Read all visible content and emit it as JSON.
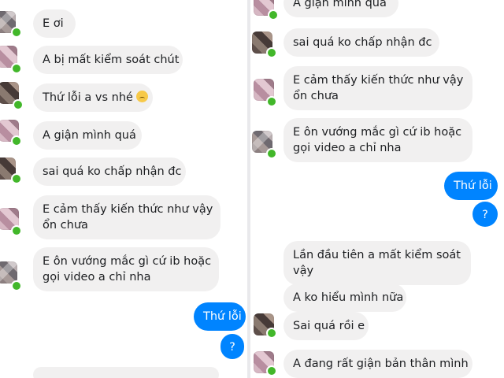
{
  "left_chat": {
    "messages": [
      {
        "text": "E ơi"
      },
      {
        "text": "A bị mất kiểm soát chút"
      },
      {
        "text": "Thứ lỗi a vs nhé"
      },
      {
        "text": "A giận mình quá"
      },
      {
        "text": "sai quá ko chấp nhận đc"
      },
      {
        "line1": "E cảm thấy kiến thức như vậy",
        "line2": "ổn chưa"
      },
      {
        "line1": "E ôn vướng mắc gì cứ ib hoặc",
        "line2": "gọi video a chỉ nha"
      }
    ],
    "sent": [
      {
        "text": "Thứ lỗi"
      },
      {
        "text": "?"
      }
    ]
  },
  "right_chat": {
    "messages": [
      {
        "text": "A giận mình quá"
      },
      {
        "text": "sai quá ko chấp nhận đc"
      },
      {
        "line1": "E cảm thấy kiến thức như vậy",
        "line2": "ổn chưa"
      },
      {
        "line1": "E ôn vướng mắc gì cứ ib hoặc",
        "line2": "gọi video a chỉ nha"
      },
      {
        "line1": "Lần đầu tiên a mất kiểm soát",
        "line2": "vậy"
      },
      {
        "text": "A ko hiểu mình nữa"
      },
      {
        "text": "Sai quá rồi e"
      },
      {
        "text": "A đang rất giận bản thân mình"
      }
    ],
    "sent": [
      {
        "text": "Thứ lỗi"
      },
      {
        "text": "?"
      }
    ]
  },
  "icons": {
    "emoji": "sad-face-emoji",
    "online": "online-status-dot"
  },
  "colors": {
    "sent_bubble": "#0084ff",
    "received_bubble": "#f1f0f0",
    "online_dot": "#42b72a"
  }
}
